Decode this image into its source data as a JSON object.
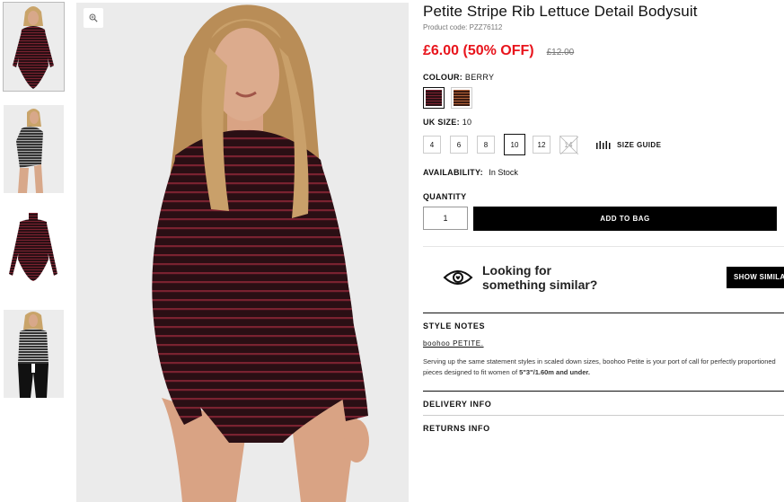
{
  "product": {
    "title": "Petite Stripe Rib Lettuce Detail Bodysuit",
    "code": "Product code: PZZ76112",
    "price_now": "£6.00 (50% OFF)",
    "price_was": "£12.00"
  },
  "colour": {
    "label": "COLOUR:",
    "value": "BERRY",
    "swatches": [
      {
        "name": "berry",
        "color": "#5a1a24"
      },
      {
        "name": "rust",
        "color": "#9a4a2a"
      }
    ]
  },
  "size": {
    "label": "UK SIZE:",
    "value": "10",
    "options": [
      "4",
      "6",
      "8",
      "10",
      "12",
      "14"
    ],
    "selected": "10",
    "guide_label": "SIZE GUIDE"
  },
  "availability": {
    "label": "AVAILABILITY:",
    "value": "In Stock"
  },
  "quantity": {
    "label": "QUANTITY",
    "value": "1"
  },
  "add_to_bag": "ADD TO BAG",
  "similar": {
    "line1": "Looking for",
    "line2": "something similar?",
    "button": "SHOW SIMILAR"
  },
  "style_notes": {
    "heading": "STYLE NOTES",
    "link": "boohoo PETITE.",
    "body": "Serving up the same statement styles in scaled down sizes, boohoo Petite is your port of call for perfectly proportioned pieces designed to fit women of ",
    "body_bold": "5\"3\"/1.60m and under."
  },
  "delivery": "DELIVERY INFO",
  "returns": "RETURNS INFO",
  "colors": {
    "sale_red": "#e8141c",
    "garment_base": "#2a0f14",
    "garment_stripe": "#7a2230"
  }
}
